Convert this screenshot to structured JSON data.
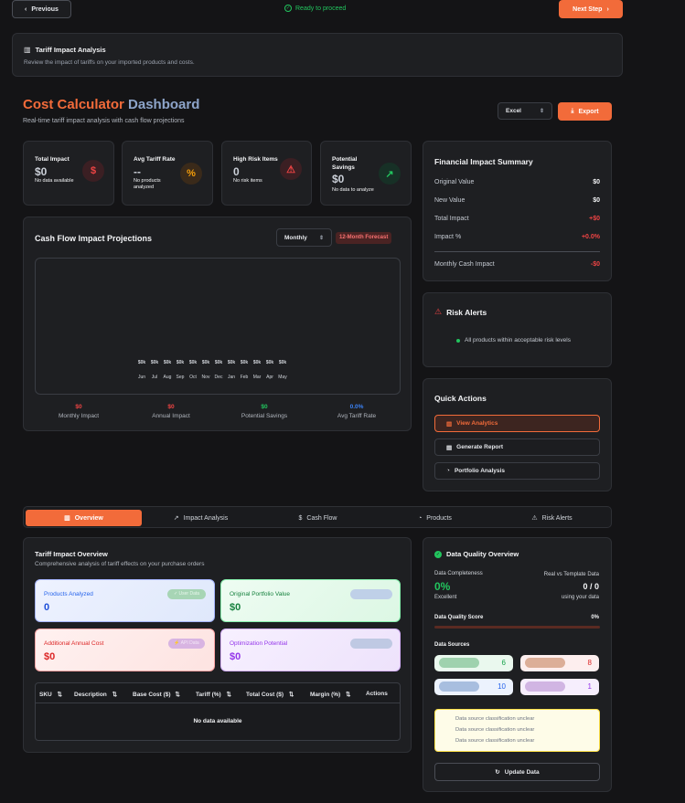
{
  "nav": {
    "previous_label": "Previous",
    "status": "Ready to proceed",
    "next_label": "Next Step"
  },
  "banner": {
    "title": "Tariff Impact Analysis",
    "subtitle": "Review the impact of tariffs on your imported products and costs."
  },
  "dashboard": {
    "title_part1": "Cost Calculator",
    "title_part2": "Dashboard",
    "subtitle": "Real-time tariff impact analysis with cash flow projections",
    "format_value": "Excel",
    "export_label": "Export"
  },
  "stats": [
    {
      "label": "Total Impact",
      "value": "$0",
      "sub": "No data available",
      "icon": "dollar-icon",
      "color": "#ef4444"
    },
    {
      "label": "Avg Tariff Rate",
      "value": "--",
      "sub": "No products analyzed",
      "icon": "percent-icon",
      "color": "#f59e0b"
    },
    {
      "label": "High Risk Items",
      "value": "0",
      "sub": "No risk items",
      "icon": "warning-icon",
      "color": "#ef4444"
    },
    {
      "label": "Potential Savings",
      "value": "$0",
      "sub": "No data to analyze",
      "icon": "trending-up-icon",
      "color": "#22c55e"
    }
  ],
  "cashflow": {
    "title": "Cash Flow Impact Projections",
    "period": "Monthly",
    "badge": "12-Month Forecast",
    "footer": [
      {
        "value": "$0",
        "label": "Monthly Impact",
        "color": "#ef4444"
      },
      {
        "value": "$0",
        "label": "Annual Impact",
        "color": "#ef4444"
      },
      {
        "value": "$0",
        "label": "Potential Savings",
        "color": "#22c55e"
      },
      {
        "value": "0.0%",
        "label": "Avg Tariff Rate",
        "color": "#3b82f6"
      }
    ]
  },
  "chart_data": {
    "type": "bar",
    "categories": [
      "Jun",
      "Jul",
      "Aug",
      "Sep",
      "Oct",
      "Nov",
      "Dec",
      "Jan",
      "Feb",
      "Mar",
      "Apr",
      "May"
    ],
    "values": [
      0,
      0,
      0,
      0,
      0,
      0,
      0,
      0,
      0,
      0,
      0,
      0
    ],
    "value_labels": [
      "$0k",
      "$0k",
      "$0k",
      "$0k",
      "$0k",
      "$0k",
      "$0k",
      "$0k",
      "$0k",
      "$0k",
      "$0k",
      "$0k"
    ],
    "title": "",
    "xlabel": "",
    "ylabel": ""
  },
  "summary": {
    "title": "Financial Impact Summary",
    "rows": [
      {
        "label": "Original Value",
        "value": "$0",
        "color": "#f3f4f6"
      },
      {
        "label": "New Value",
        "value": "$0",
        "color": "#f3f4f6"
      },
      {
        "label": "Total Impact",
        "value": "+$0",
        "color": "#ef4444"
      },
      {
        "label": "Impact %",
        "value": "+0.0%",
        "color": "#ef4444"
      }
    ],
    "monthly": {
      "label": "Monthly Cash Impact",
      "value": "-$0",
      "color": "#ef4444"
    }
  },
  "risk": {
    "title": "Risk Alerts",
    "message": "All products within acceptable risk levels"
  },
  "actions": {
    "title": "Quick Actions",
    "items": [
      "View Analytics",
      "Generate Report",
      "Portfolio Analysis"
    ]
  },
  "tabs": [
    "Overview",
    "Impact Analysis",
    "Cash Flow",
    "Products",
    "Risk Alerts"
  ],
  "overview": {
    "title": "Tariff Impact Overview",
    "subtitle": "Comprehensive analysis of tariff effects on your purchase orders",
    "cards": [
      {
        "label": "Products Analyzed",
        "value": "0",
        "badge": "User Data"
      },
      {
        "label": "Original Portfolio Value",
        "value": "$0",
        "badge": ""
      },
      {
        "label": "Additional Annual Cost",
        "value": "$0",
        "badge": "API Data"
      },
      {
        "label": "Optimization Potential",
        "value": "$0",
        "badge": ""
      }
    ],
    "columns": [
      "SKU",
      "Description",
      "Base Cost ($)",
      "Tariff (%)",
      "Total Cost ($)",
      "Margin (%)",
      "Actions"
    ],
    "empty": "No data available"
  },
  "quality": {
    "title": "Data Quality Overview",
    "completeness_label": "Data Completeness",
    "completeness_value": "0%",
    "completeness_sub": "Excellent",
    "real_label": "Real vs Template Data",
    "real_value": "0 / 0",
    "real_sub": "using your data",
    "score_label": "Data Quality Score",
    "score_value": "0%",
    "score_fraction": 0,
    "sources_label": "Data Sources",
    "sources": [
      {
        "value": "6",
        "color": "#16a34a"
      },
      {
        "value": "8",
        "color": "#dc2626"
      },
      {
        "value": "10",
        "color": "#2563eb"
      },
      {
        "value": "1",
        "color": "#9333ea"
      }
    ],
    "notes": [
      "Data source classification unclear",
      "Data source classification unclear",
      "Data source classification unclear"
    ],
    "update_label": "Update Data"
  }
}
